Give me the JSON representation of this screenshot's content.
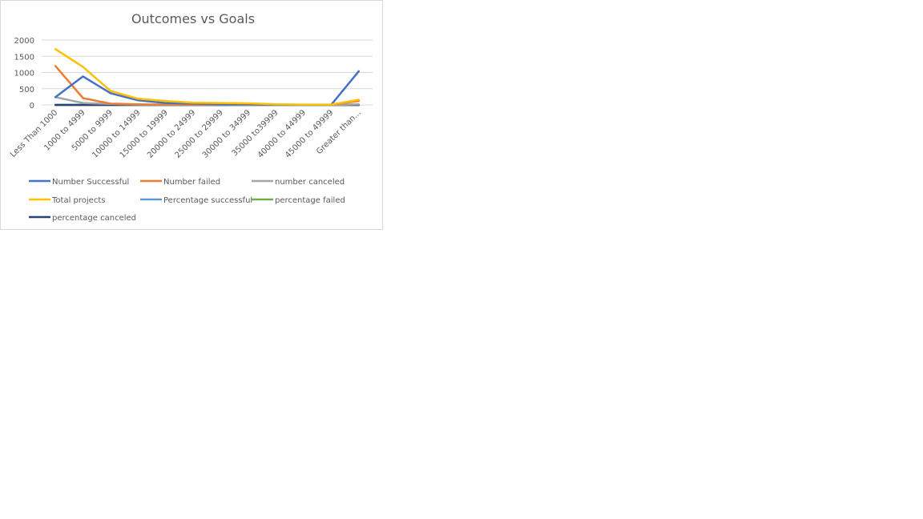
{
  "chart_data": {
    "type": "line",
    "title": "Outcomes vs Goals",
    "xlabel": "",
    "ylabel": "",
    "categories": [
      "Less Than 1000",
      "1000 to 4999",
      "5000 to 9999",
      "10000 to 14999",
      "15000 to 19999",
      "20000 to 24999",
      "25000 to 29999",
      "30000 to 34999",
      "35000 to39999",
      "40000 to 44999",
      "45000 to 49999",
      "Greater than..."
    ],
    "ylim": [
      0,
      2000
    ],
    "yticks": [
      0,
      500,
      1000,
      1500,
      2000
    ],
    "grid": true,
    "legend_position": "bottom",
    "series": [
      {
        "name": "Number Successful",
        "color": "#4472c4",
        "values": [
          240,
          880,
          360,
          140,
          60,
          40,
          20,
          20,
          10,
          5,
          5,
          1040
        ]
      },
      {
        "name": "Number failed",
        "color": "#ed7d31",
        "values": [
          1200,
          210,
          40,
          20,
          10,
          10,
          10,
          5,
          5,
          5,
          5,
          120
        ]
      },
      {
        "name": "number canceled",
        "color": "#a5a5a5",
        "values": [
          240,
          60,
          30,
          10,
          5,
          5,
          5,
          0,
          0,
          0,
          0,
          20
        ]
      },
      {
        "name": "Total projects",
        "color": "#ffc000",
        "values": [
          1720,
          1170,
          430,
          190,
          120,
          70,
          60,
          50,
          20,
          10,
          10,
          160
        ]
      },
      {
        "name": "Percentage successful",
        "color": "#5b9bd5",
        "values": [
          0,
          0,
          0,
          0,
          0,
          0,
          0,
          0,
          0,
          0,
          0,
          0
        ]
      },
      {
        "name": "percentage failed",
        "color": "#70ad47",
        "values": [
          0,
          0,
          0,
          0,
          0,
          0,
          0,
          0,
          0,
          0,
          0,
          0
        ]
      },
      {
        "name": "percentage canceled",
        "color": "#264478",
        "values": [
          0,
          0,
          0,
          0,
          0,
          0,
          0,
          0,
          0,
          0,
          0,
          0
        ]
      }
    ]
  }
}
